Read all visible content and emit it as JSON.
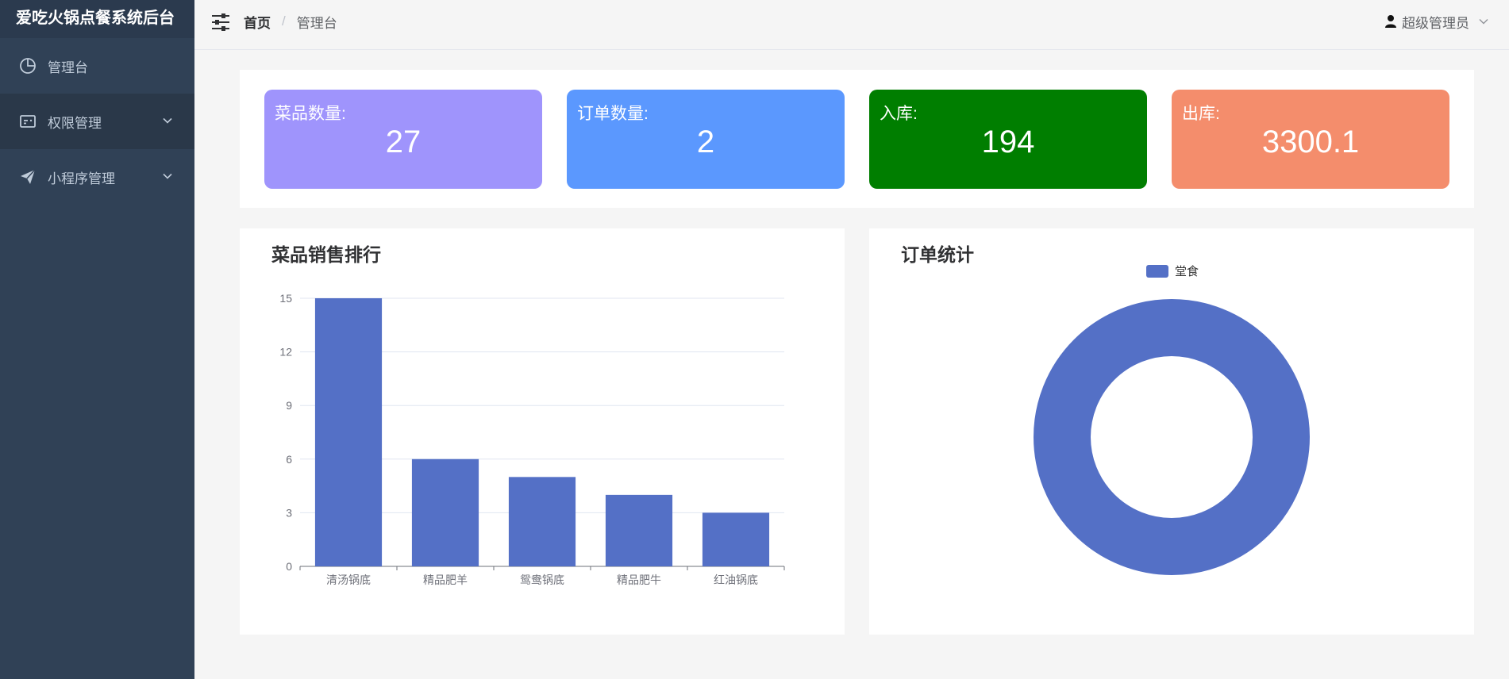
{
  "app": {
    "title": "爱吃火锅点餐系统后台"
  },
  "sidebar": {
    "items": [
      {
        "label": "管理台",
        "icon": "pie-chart-icon"
      },
      {
        "label": "权限管理",
        "icon": "id-card-icon"
      },
      {
        "label": "小程序管理",
        "icon": "paper-plane-icon"
      }
    ]
  },
  "header": {
    "breadcrumb": {
      "home": "首页",
      "separator": "/",
      "current": "管理台"
    },
    "user": "超级管理员"
  },
  "stats": [
    {
      "label": "菜品数量:",
      "value": "27",
      "color": "#9f94fc"
    },
    {
      "label": "订单数量:",
      "value": "2",
      "color": "#5b98fe"
    },
    {
      "label": "入库:",
      "value": "194",
      "color": "#007e00"
    },
    {
      "label": "出库:",
      "value": "3300.1",
      "color": "#f48d6c"
    }
  ],
  "sales_panel": {
    "title": "菜品销售排行"
  },
  "order_panel": {
    "title": "订单统计"
  },
  "chart_data": [
    {
      "type": "bar",
      "title": "菜品销售排行",
      "categories": [
        "清汤锅底",
        "精品肥羊",
        "鸳鸯锅底",
        "精品肥牛",
        "红油锅底"
      ],
      "values": [
        15,
        6,
        5,
        4,
        3
      ],
      "yticks": [
        0,
        3,
        6,
        9,
        12,
        15
      ],
      "ylim": [
        0,
        15
      ],
      "grid": true,
      "color": "#5470c6"
    },
    {
      "type": "pie",
      "title": "订单统计",
      "legend": [
        "堂食"
      ],
      "legend_position": "top-center",
      "slices": [
        {
          "name": "堂食",
          "value": 2
        }
      ],
      "donut": true,
      "color": "#5470c6"
    }
  ]
}
